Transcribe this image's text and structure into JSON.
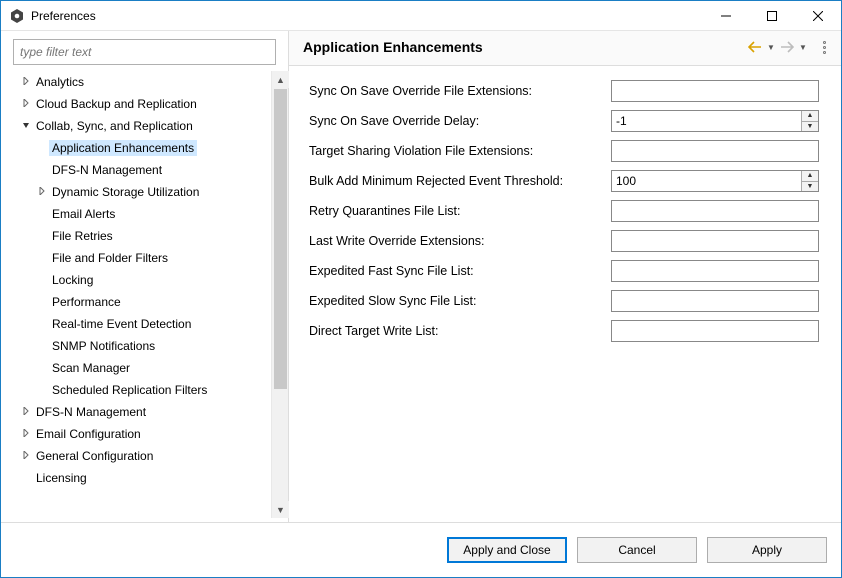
{
  "window": {
    "title": "Preferences"
  },
  "filter": {
    "placeholder": "type filter text"
  },
  "tree": [
    {
      "label": "Analytics",
      "depth": 0,
      "arrow": "right",
      "selected": false
    },
    {
      "label": "Cloud Backup and Replication",
      "depth": 0,
      "arrow": "right",
      "selected": false
    },
    {
      "label": "Collab, Sync, and Replication",
      "depth": 0,
      "arrow": "down",
      "selected": false
    },
    {
      "label": "Application Enhancements",
      "depth": 1,
      "arrow": "",
      "selected": true
    },
    {
      "label": "DFS-N Management",
      "depth": 1,
      "arrow": "",
      "selected": false
    },
    {
      "label": "Dynamic Storage Utilization",
      "depth": 1,
      "arrow": "right",
      "selected": false
    },
    {
      "label": "Email Alerts",
      "depth": 1,
      "arrow": "",
      "selected": false
    },
    {
      "label": "File Retries",
      "depth": 1,
      "arrow": "",
      "selected": false
    },
    {
      "label": "File and Folder Filters",
      "depth": 1,
      "arrow": "",
      "selected": false
    },
    {
      "label": "Locking",
      "depth": 1,
      "arrow": "",
      "selected": false
    },
    {
      "label": "Performance",
      "depth": 1,
      "arrow": "",
      "selected": false
    },
    {
      "label": "Real-time Event Detection",
      "depth": 1,
      "arrow": "",
      "selected": false
    },
    {
      "label": "SNMP Notifications",
      "depth": 1,
      "arrow": "",
      "selected": false
    },
    {
      "label": "Scan Manager",
      "depth": 1,
      "arrow": "",
      "selected": false
    },
    {
      "label": "Scheduled Replication Filters",
      "depth": 1,
      "arrow": "",
      "selected": false
    },
    {
      "label": "DFS-N Management",
      "depth": 0,
      "arrow": "right",
      "selected": false
    },
    {
      "label": "Email Configuration",
      "depth": 0,
      "arrow": "right",
      "selected": false
    },
    {
      "label": "General Configuration",
      "depth": 0,
      "arrow": "right",
      "selected": false
    },
    {
      "label": "Licensing",
      "depth": 0,
      "arrow": "",
      "selected": false
    }
  ],
  "page": {
    "heading": "Application Enhancements"
  },
  "fields": [
    {
      "label": "Sync On Save Override File Extensions:",
      "type": "text",
      "value": ""
    },
    {
      "label": "Sync On Save Override Delay:",
      "type": "spin",
      "value": "-1"
    },
    {
      "label": "Target Sharing Violation File Extensions:",
      "type": "text",
      "value": ""
    },
    {
      "label": "Bulk Add Minimum Rejected Event Threshold:",
      "type": "spin",
      "value": "100"
    },
    {
      "label": "Retry Quarantines File List:",
      "type": "text",
      "value": ""
    },
    {
      "label": "Last Write Override Extensions:",
      "type": "text",
      "value": ""
    },
    {
      "label": "Expedited Fast Sync File List:",
      "type": "text",
      "value": ""
    },
    {
      "label": "Expedited Slow Sync File List:",
      "type": "text",
      "value": ""
    },
    {
      "label": "Direct Target Write List:",
      "type": "text",
      "value": ""
    }
  ],
  "buttons": {
    "apply_close": "Apply and Close",
    "cancel": "Cancel",
    "apply": "Apply"
  }
}
